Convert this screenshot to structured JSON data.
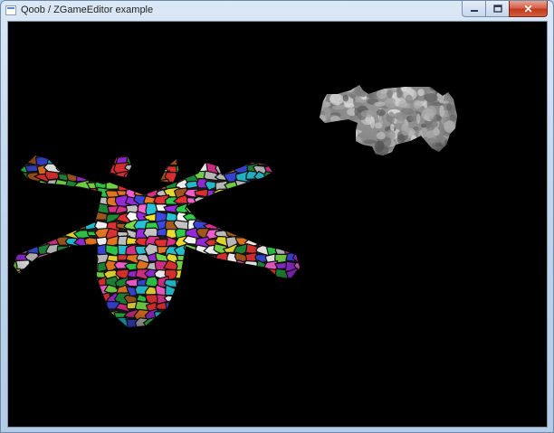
{
  "window": {
    "title": "Qoob / ZGameEditor example",
    "buttons": {
      "minimize_icon": "minimize-icon",
      "maximize_icon": "maximize-icon",
      "close_icon": "close-icon",
      "close_glyph": "✕"
    }
  },
  "viewport": {
    "background": "#000000",
    "objects": [
      {
        "name": "textured-spaceship",
        "texture": "voronoi-multicolor"
      },
      {
        "name": "grey-creature",
        "texture": "grey-noise"
      }
    ]
  },
  "colors": {
    "close_button": "#c2391e",
    "frame": "#b9d1ea",
    "mosaic": [
      "#e0308c",
      "#2fd14a",
      "#3b49e3",
      "#f2e233",
      "#9b2be0",
      "#f07a22",
      "#26c6d9",
      "#c8c8c8",
      "#e83232",
      "#7be04a",
      "#ff63d6",
      "#1e8f3a",
      "#a85a1e",
      "#ffffff"
    ]
  }
}
